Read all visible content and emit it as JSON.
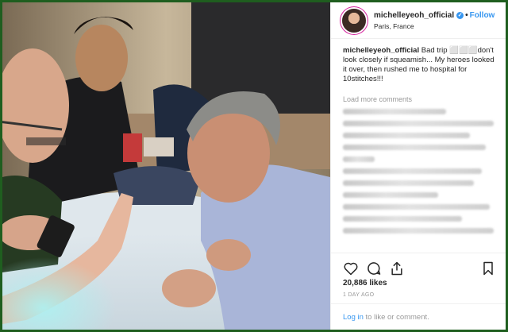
{
  "post": {
    "username": "michelleyeoh_official",
    "verified_icon": "verified-badge-icon",
    "dot": "•",
    "follow_label": "Follow",
    "location": "Paris, France",
    "caption_text": "Bad trip ⬜⬜⬜don't look closely if squeamish... My heroes looked it over, then rushed me to hospital for 10stitches!!!",
    "load_more_label": "Load more comments",
    "likes": "20,886 likes",
    "timestamp": "1 DAY AGO",
    "login_link": "Log in",
    "login_suffix": " to like or comment."
  },
  "icons": {
    "like": "heart-icon",
    "comment": "comment-icon",
    "share": "share-icon",
    "save": "bookmark-icon"
  },
  "colors": {
    "frame_border": "#1f5e1f",
    "link_blue": "#3897f0",
    "text": "#262626",
    "muted": "#999999"
  }
}
